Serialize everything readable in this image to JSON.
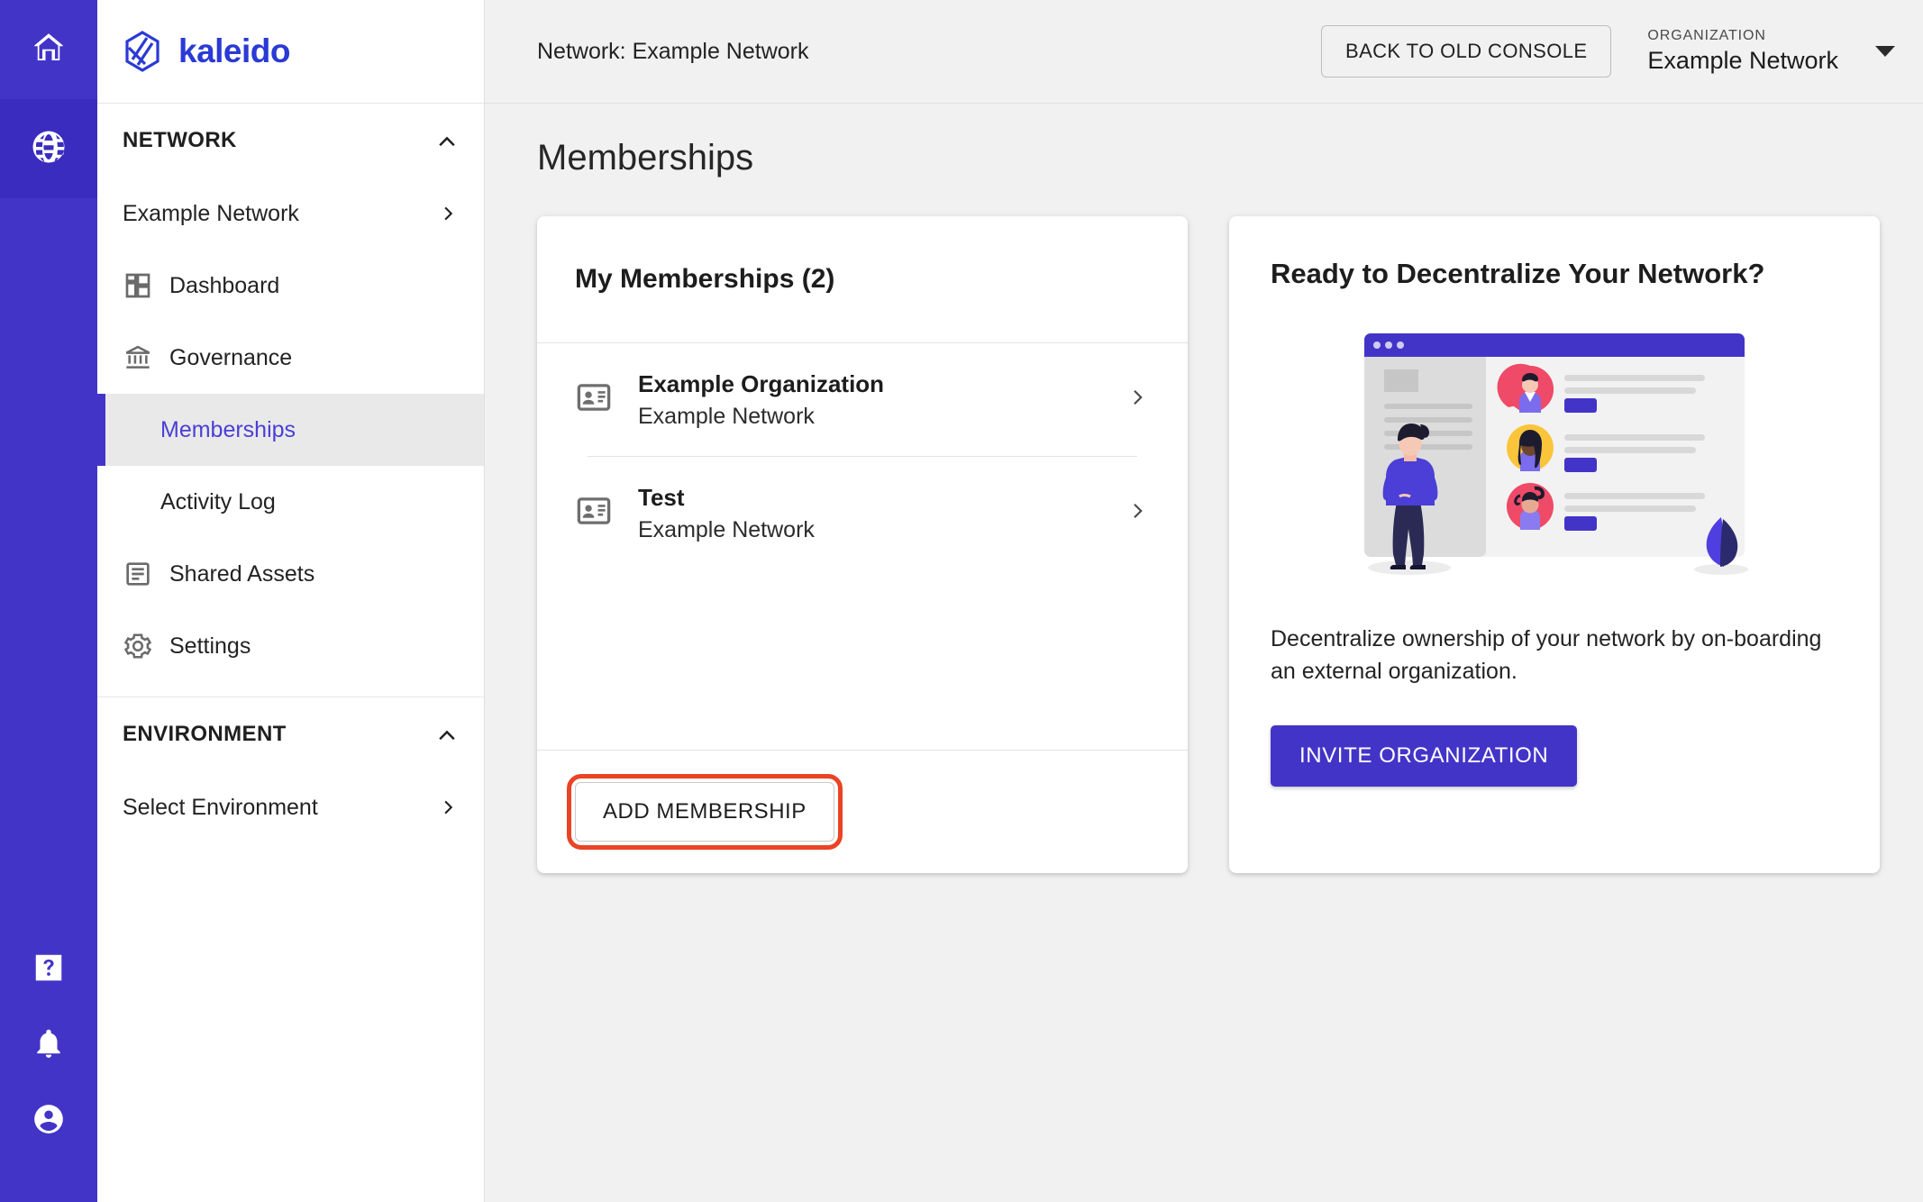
{
  "rail": {
    "items": [
      {
        "name": "home-icon",
        "label": "Home",
        "active": false
      },
      {
        "name": "globe-icon",
        "label": "Network",
        "active": true
      }
    ],
    "bottom_items": [
      {
        "name": "help-icon",
        "label": "Help"
      },
      {
        "name": "bell-icon",
        "label": "Notifications"
      },
      {
        "name": "account-icon",
        "label": "Account"
      }
    ],
    "background_color": "#4334c8"
  },
  "brand": {
    "name": "kaleido",
    "color": "#2a3ad4",
    "logo_icon": "kaleido-hexagon-logo"
  },
  "sidebar": {
    "network_section": {
      "title": "NETWORK",
      "collapse_icon": "chevron-up-icon",
      "network_name": "Example Network",
      "network_chevron_icon": "chevron-right-icon",
      "items": [
        {
          "label": "Dashboard",
          "icon": "dashboard-grid-icon",
          "active": false,
          "sub": false
        },
        {
          "label": "Governance",
          "icon": "bank-columns-icon",
          "active": false,
          "sub": false
        },
        {
          "label": "Memberships",
          "icon": "",
          "active": true,
          "sub": true
        },
        {
          "label": "Activity Log",
          "icon": "",
          "active": false,
          "sub": true
        },
        {
          "label": "Shared Assets",
          "icon": "document-list-icon",
          "active": false,
          "sub": false
        },
        {
          "label": "Settings",
          "icon": "gear-icon",
          "active": false,
          "sub": false
        }
      ]
    },
    "environment_section": {
      "title": "ENVIRONMENT",
      "collapse_icon": "chevron-up-icon",
      "select_label": "Select Environment",
      "select_chevron_icon": "chevron-right-icon"
    }
  },
  "topbar": {
    "network_label": "Network: Example Network",
    "back_to_old_console": "BACK TO OLD CONSOLE",
    "organization_caption": "ORGANIZATION",
    "organization_value": "Example Network",
    "dropdown_icon": "caret-down-icon"
  },
  "page": {
    "title": "Memberships"
  },
  "memberships_card": {
    "heading": "My Memberships (2)",
    "count": 2,
    "rows": [
      {
        "icon": "contact-badge-icon",
        "title": "Example Organization",
        "subtitle": "Example Network",
        "chevron_icon": "chevron-right-icon"
      },
      {
        "icon": "contact-badge-icon",
        "title": "Test",
        "subtitle": "Example Network",
        "chevron_icon": "chevron-right-icon"
      }
    ],
    "add_button_label": "ADD MEMBERSHIP",
    "add_button_highlight_color": "#ea4325"
  },
  "decentralize_card": {
    "heading": "Ready to Decentralize Your Network?",
    "illustration": "team-dashboard-illustration",
    "body": "Decentralize ownership of your network by on-boarding an external organization.",
    "button_label": "INVITE ORGANIZATION",
    "button_color": "#4334c8"
  }
}
